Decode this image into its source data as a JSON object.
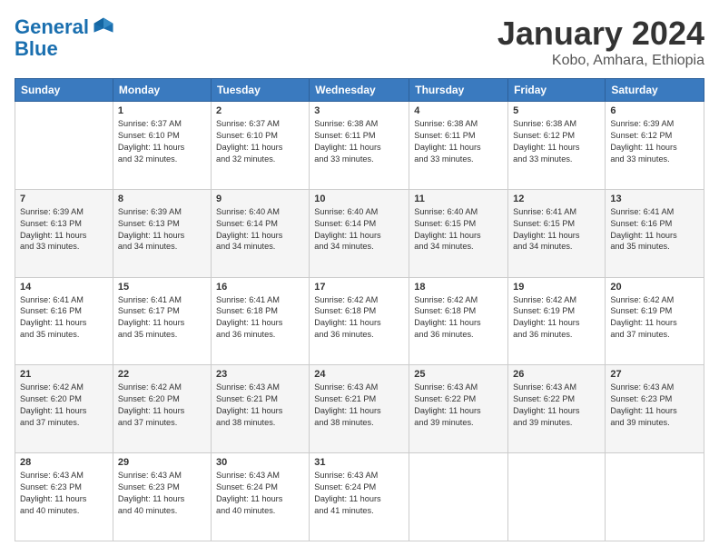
{
  "header": {
    "logo": "GeneralBlue",
    "title": "January 2024",
    "subtitle": "Kobo, Amhara, Ethiopia"
  },
  "days_of_week": [
    "Sunday",
    "Monday",
    "Tuesday",
    "Wednesday",
    "Thursday",
    "Friday",
    "Saturday"
  ],
  "weeks": [
    [
      {
        "day": "",
        "info": ""
      },
      {
        "day": "1",
        "info": "Sunrise: 6:37 AM\nSunset: 6:10 PM\nDaylight: 11 hours\nand 32 minutes."
      },
      {
        "day": "2",
        "info": "Sunrise: 6:37 AM\nSunset: 6:10 PM\nDaylight: 11 hours\nand 32 minutes."
      },
      {
        "day": "3",
        "info": "Sunrise: 6:38 AM\nSunset: 6:11 PM\nDaylight: 11 hours\nand 33 minutes."
      },
      {
        "day": "4",
        "info": "Sunrise: 6:38 AM\nSunset: 6:11 PM\nDaylight: 11 hours\nand 33 minutes."
      },
      {
        "day": "5",
        "info": "Sunrise: 6:38 AM\nSunset: 6:12 PM\nDaylight: 11 hours\nand 33 minutes."
      },
      {
        "day": "6",
        "info": "Sunrise: 6:39 AM\nSunset: 6:12 PM\nDaylight: 11 hours\nand 33 minutes."
      }
    ],
    [
      {
        "day": "7",
        "info": "Sunrise: 6:39 AM\nSunset: 6:13 PM\nDaylight: 11 hours\nand 33 minutes."
      },
      {
        "day": "8",
        "info": "Sunrise: 6:39 AM\nSunset: 6:13 PM\nDaylight: 11 hours\nand 34 minutes."
      },
      {
        "day": "9",
        "info": "Sunrise: 6:40 AM\nSunset: 6:14 PM\nDaylight: 11 hours\nand 34 minutes."
      },
      {
        "day": "10",
        "info": "Sunrise: 6:40 AM\nSunset: 6:14 PM\nDaylight: 11 hours\nand 34 minutes."
      },
      {
        "day": "11",
        "info": "Sunrise: 6:40 AM\nSunset: 6:15 PM\nDaylight: 11 hours\nand 34 minutes."
      },
      {
        "day": "12",
        "info": "Sunrise: 6:41 AM\nSunset: 6:15 PM\nDaylight: 11 hours\nand 34 minutes."
      },
      {
        "day": "13",
        "info": "Sunrise: 6:41 AM\nSunset: 6:16 PM\nDaylight: 11 hours\nand 35 minutes."
      }
    ],
    [
      {
        "day": "14",
        "info": "Sunrise: 6:41 AM\nSunset: 6:16 PM\nDaylight: 11 hours\nand 35 minutes."
      },
      {
        "day": "15",
        "info": "Sunrise: 6:41 AM\nSunset: 6:17 PM\nDaylight: 11 hours\nand 35 minutes."
      },
      {
        "day": "16",
        "info": "Sunrise: 6:41 AM\nSunset: 6:18 PM\nDaylight: 11 hours\nand 36 minutes."
      },
      {
        "day": "17",
        "info": "Sunrise: 6:42 AM\nSunset: 6:18 PM\nDaylight: 11 hours\nand 36 minutes."
      },
      {
        "day": "18",
        "info": "Sunrise: 6:42 AM\nSunset: 6:18 PM\nDaylight: 11 hours\nand 36 minutes."
      },
      {
        "day": "19",
        "info": "Sunrise: 6:42 AM\nSunset: 6:19 PM\nDaylight: 11 hours\nand 36 minutes."
      },
      {
        "day": "20",
        "info": "Sunrise: 6:42 AM\nSunset: 6:19 PM\nDaylight: 11 hours\nand 37 minutes."
      }
    ],
    [
      {
        "day": "21",
        "info": "Sunrise: 6:42 AM\nSunset: 6:20 PM\nDaylight: 11 hours\nand 37 minutes."
      },
      {
        "day": "22",
        "info": "Sunrise: 6:42 AM\nSunset: 6:20 PM\nDaylight: 11 hours\nand 37 minutes."
      },
      {
        "day": "23",
        "info": "Sunrise: 6:43 AM\nSunset: 6:21 PM\nDaylight: 11 hours\nand 38 minutes."
      },
      {
        "day": "24",
        "info": "Sunrise: 6:43 AM\nSunset: 6:21 PM\nDaylight: 11 hours\nand 38 minutes."
      },
      {
        "day": "25",
        "info": "Sunrise: 6:43 AM\nSunset: 6:22 PM\nDaylight: 11 hours\nand 39 minutes."
      },
      {
        "day": "26",
        "info": "Sunrise: 6:43 AM\nSunset: 6:22 PM\nDaylight: 11 hours\nand 39 minutes."
      },
      {
        "day": "27",
        "info": "Sunrise: 6:43 AM\nSunset: 6:23 PM\nDaylight: 11 hours\nand 39 minutes."
      }
    ],
    [
      {
        "day": "28",
        "info": "Sunrise: 6:43 AM\nSunset: 6:23 PM\nDaylight: 11 hours\nand 40 minutes."
      },
      {
        "day": "29",
        "info": "Sunrise: 6:43 AM\nSunset: 6:23 PM\nDaylight: 11 hours\nand 40 minutes."
      },
      {
        "day": "30",
        "info": "Sunrise: 6:43 AM\nSunset: 6:24 PM\nDaylight: 11 hours\nand 40 minutes."
      },
      {
        "day": "31",
        "info": "Sunrise: 6:43 AM\nSunset: 6:24 PM\nDaylight: 11 hours\nand 41 minutes."
      },
      {
        "day": "",
        "info": ""
      },
      {
        "day": "",
        "info": ""
      },
      {
        "day": "",
        "info": ""
      }
    ]
  ]
}
